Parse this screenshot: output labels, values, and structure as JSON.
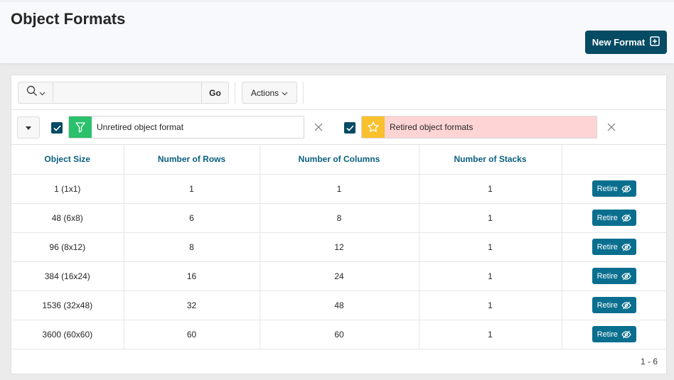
{
  "page": {
    "title": "Object Formats"
  },
  "header": {
    "new_button_label": "New Format"
  },
  "toolbar": {
    "search_value": "",
    "go_label": "Go",
    "actions_label": "Actions"
  },
  "filters": [
    {
      "label": "Unretired object format",
      "checked": true,
      "icon": "filter-icon",
      "color": "#2bc06b"
    },
    {
      "label": "Retired object formats",
      "checked": true,
      "icon": "star-icon",
      "color": "#fbc02d"
    }
  ],
  "table": {
    "columns": [
      "Object Size",
      "Number of Rows",
      "Number of Columns",
      "Number of Stacks",
      ""
    ],
    "rows": [
      {
        "size": "1 (1x1)",
        "rows": "1",
        "cols": "1",
        "stacks": "1",
        "action": "Retire"
      },
      {
        "size": "48 (6x8)",
        "rows": "6",
        "cols": "8",
        "stacks": "1",
        "action": "Retire"
      },
      {
        "size": "96 (8x12)",
        "rows": "8",
        "cols": "12",
        "stacks": "1",
        "action": "Retire"
      },
      {
        "size": "384 (16x24)",
        "rows": "16",
        "cols": "24",
        "stacks": "1",
        "action": "Retire"
      },
      {
        "size": "1536 (32x48)",
        "rows": "32",
        "cols": "48",
        "stacks": "1",
        "action": "Retire"
      },
      {
        "size": "3600 (60x60)",
        "rows": "60",
        "cols": "60",
        "stacks": "1",
        "action": "Retire"
      }
    ]
  },
  "pagination": {
    "text": "1 - 6"
  },
  "colors": {
    "primary": "#054b63",
    "accent": "#0a6f8f",
    "header_text": "#0a5f80",
    "retired_bg": "#ffd4d4"
  }
}
